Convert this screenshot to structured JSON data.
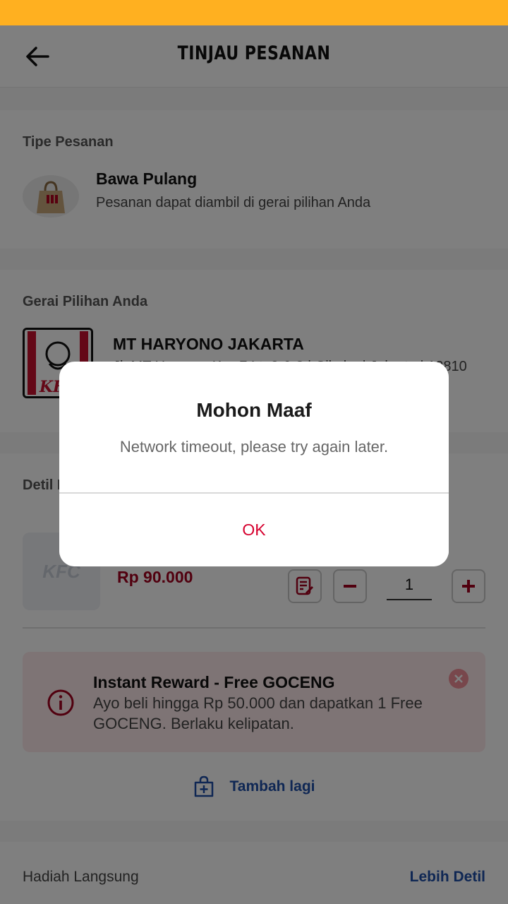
{
  "header": {
    "title": "TINJAU PESANAN"
  },
  "order_type": {
    "section_title": "Tipe Pesanan",
    "name": "Bawa Pulang",
    "description": "Pesanan dapat diambil di gerai pilihan Anda"
  },
  "store": {
    "section_title": "Gerai Pilihan Anda",
    "name": "MT HARYONO JAKARTA",
    "address": "Jl. MT Haryono Kav.7 Lt. 2 & 3 | Cikoko | Jakarta | 12810",
    "logo_text": "KFC"
  },
  "order_detail": {
    "section_title": "Detil Pesanan",
    "item": {
      "thumb_text": "KFC",
      "price": "Rp 90.000",
      "quantity": "1"
    },
    "reward": {
      "title": "Instant Reward - Free GOCENG",
      "text": "Ayo beli hingga Rp 50.000 dan dapatkan 1 Free GOCENG. Berlaku kelipatan."
    },
    "add_more_label": "Tambah lagi"
  },
  "bottom": {
    "left_label": "Hadiah Langsung",
    "right_link": "Lebih Detil"
  },
  "dialog": {
    "title": "Mohon Maaf",
    "message": "Network timeout, please try again later.",
    "ok_label": "OK"
  },
  "colors": {
    "status_bar": "#ffb020",
    "accent_red": "#a3001e",
    "link_blue": "#1f4fa8",
    "dialog_ok": "#d6002e"
  }
}
